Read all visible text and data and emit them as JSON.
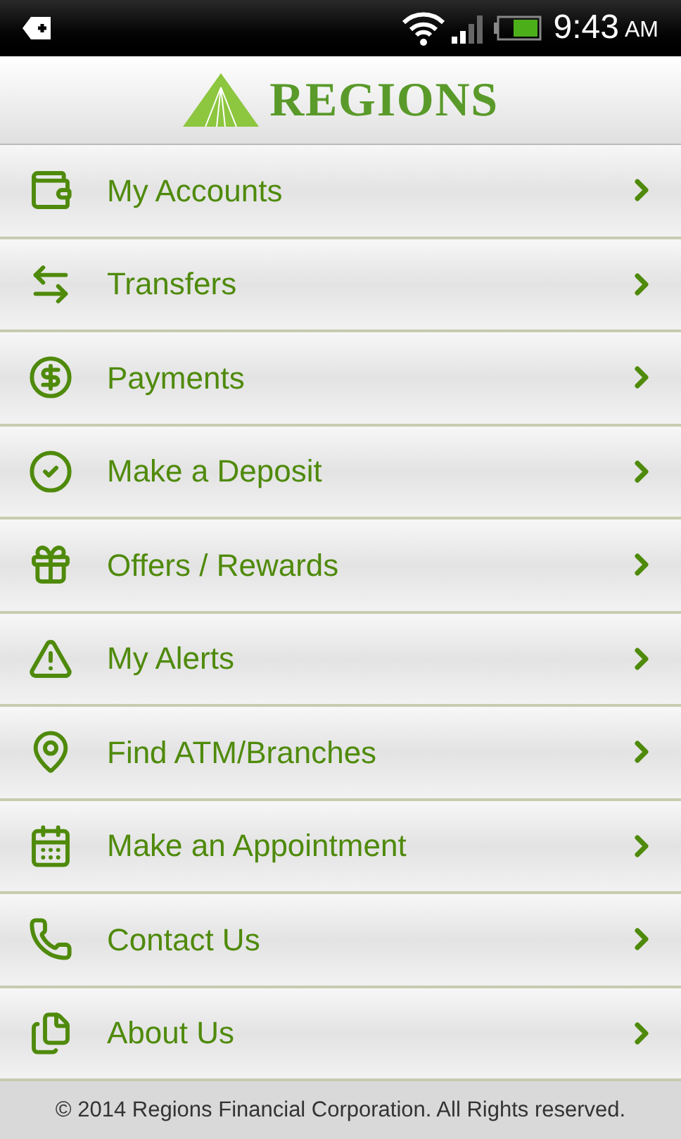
{
  "status_bar": {
    "time": "9:43",
    "meridiem": "AM"
  },
  "header": {
    "logo_text": "REGIONS"
  },
  "menu": [
    {
      "label": "My Accounts"
    },
    {
      "label": "Transfers"
    },
    {
      "label": "Payments"
    },
    {
      "label": "Make a Deposit"
    },
    {
      "label": "Offers / Rewards"
    },
    {
      "label": "My Alerts"
    },
    {
      "label": "Find ATM/Branches"
    },
    {
      "label": "Make an Appointment"
    },
    {
      "label": "Contact Us"
    },
    {
      "label": "About Us"
    }
  ],
  "footer": "© 2014 Regions Financial Corporation. All Rights reserved."
}
